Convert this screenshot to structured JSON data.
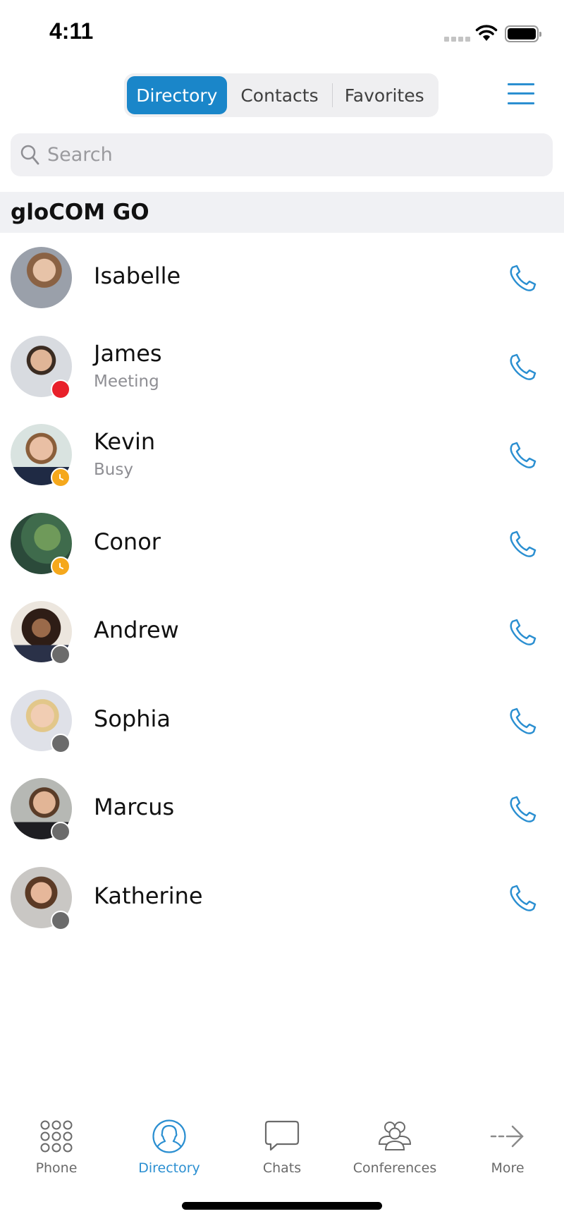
{
  "status_bar": {
    "time": "4:11",
    "signal_icon": "cellular-signal-icon",
    "wifi_icon": "wifi-icon",
    "battery_icon": "battery-icon"
  },
  "segmented_control": {
    "tabs": [
      {
        "label": "Directory",
        "active": true
      },
      {
        "label": "Contacts",
        "active": false
      },
      {
        "label": "Favorites",
        "active": false
      }
    ]
  },
  "menu": {
    "icon": "hamburger-menu-icon"
  },
  "search": {
    "placeholder": "Search",
    "value": "",
    "icon": "search-icon"
  },
  "section": {
    "title": "gloCOM GO"
  },
  "contacts": [
    {
      "name": "Isabelle",
      "status": "",
      "presence": "none"
    },
    {
      "name": "James",
      "status": "Meeting",
      "presence": "dnd"
    },
    {
      "name": "Kevin",
      "status": "Busy",
      "presence": "away"
    },
    {
      "name": "Conor",
      "status": "",
      "presence": "away"
    },
    {
      "name": "Andrew",
      "status": "",
      "presence": "offline"
    },
    {
      "name": "Sophia",
      "status": "",
      "presence": "offline"
    },
    {
      "name": "Marcus",
      "status": "",
      "presence": "offline"
    },
    {
      "name": "Katherine",
      "status": "",
      "presence": "offline"
    }
  ],
  "presence_colors": {
    "dnd": "#e8202a",
    "away": "#f5a81c",
    "offline": "#6b6b6b"
  },
  "tab_bar": {
    "tabs": [
      {
        "label": "Phone",
        "icon": "dialpad-icon",
        "active": false
      },
      {
        "label": "Directory",
        "icon": "user-circle-icon",
        "active": true
      },
      {
        "label": "Chats",
        "icon": "chat-bubble-icon",
        "active": false
      },
      {
        "label": "Conferences",
        "icon": "group-icon",
        "active": false
      },
      {
        "label": "More",
        "icon": "dashed-arrow-right-icon",
        "active": false
      }
    ]
  },
  "colors": {
    "accent": "#1a86c9",
    "icon_blue": "#2b8fd1",
    "inactive_gray": "#6a6a6a"
  }
}
